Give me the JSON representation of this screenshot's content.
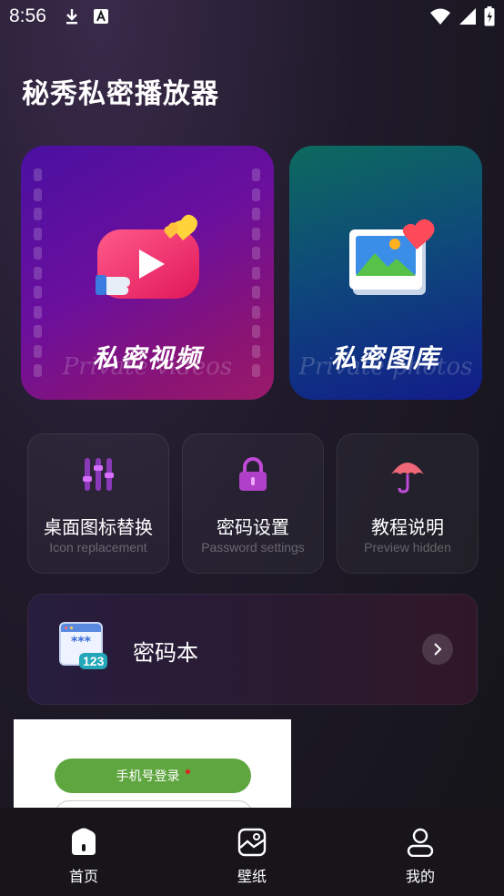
{
  "status_bar": {
    "time": "8:56",
    "icons_left": [
      "download-icon",
      "font-a-icon"
    ],
    "icons_right": [
      "wifi-icon",
      "signal-icon",
      "battery-icon"
    ]
  },
  "app": {
    "title": "秘秀私密播放器"
  },
  "cards": {
    "video": {
      "label": "私密视频",
      "subtitle": "Private videos",
      "icon": "video-play-icon"
    },
    "gallery": {
      "label": "私密图库",
      "subtitle": "Private photos",
      "icon": "photo-gallery-icon"
    }
  },
  "tiles": [
    {
      "title": "桌面图标替换",
      "subtitle": "Icon replacement",
      "icon": "sliders-icon"
    },
    {
      "title": "密码设置",
      "subtitle": "Password settings",
      "icon": "lock-icon"
    },
    {
      "title": "教程说明",
      "subtitle": "Preview  hidden",
      "icon": "umbrella-icon"
    }
  ],
  "notebook": {
    "label": "密码本",
    "icon": "password-book-icon",
    "badge": "123",
    "stars": "***"
  },
  "login_overlay": {
    "phone_login_label": "手机号登录"
  },
  "bottom_nav": [
    {
      "label": "首页",
      "icon": "home-icon"
    },
    {
      "label": "壁纸",
      "icon": "wallpaper-icon"
    },
    {
      "label": "我的",
      "icon": "profile-icon"
    }
  ],
  "colors": {
    "video_card": "#6a0f9e",
    "gallery_card": "#0e4a7a",
    "tile_icon": "#b34bd8",
    "login_green": "#5fa640"
  }
}
